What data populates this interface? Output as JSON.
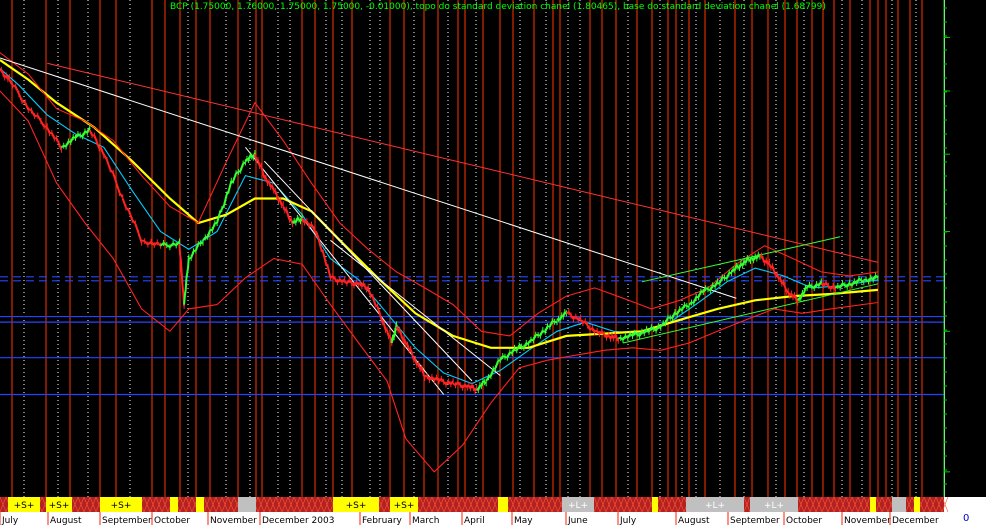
{
  "chart_data": {
    "type": "line",
    "title": "BCP (1.75000, 1.76000, 1.75000, 1.75000, -0.01000), topo do standard deviation chanel (1.80465), base do standard deviation chanel (1.68799)",
    "y_scale": "log",
    "ylim": [
      0.93,
      3.9
    ],
    "yticks": [
      "3.5",
      "3.0",
      "2.5",
      "2.0",
      "1.5",
      "1.0"
    ],
    "ytick_values": [
      3.5,
      3.0,
      2.5,
      2.0,
      1.5,
      1.0
    ],
    "month_labels": [
      "July",
      "August",
      "September",
      "October",
      "November",
      "December 2003",
      "February",
      "March",
      "April",
      "May",
      "June",
      "July",
      "August",
      "September",
      "October",
      "November",
      "December"
    ],
    "signal_labels": [
      "+S+",
      "+S+",
      "+S+",
      "+S+",
      "+S+",
      "+L+",
      "+L+",
      "+L+"
    ],
    "corner_label": "0",
    "x_range": [
      0,
      1
    ],
    "price_points": [
      [
        0.0,
        3.18
      ],
      [
        0.01,
        3.1
      ],
      [
        0.03,
        2.85
      ],
      [
        0.05,
        2.7
      ],
      [
        0.065,
        2.55
      ],
      [
        0.08,
        2.62
      ],
      [
        0.095,
        2.68
      ],
      [
        0.11,
        2.5
      ],
      [
        0.13,
        2.2
      ],
      [
        0.15,
        1.95
      ],
      [
        0.17,
        1.92
      ],
      [
        0.19,
        1.93
      ],
      [
        0.195,
        1.62
      ],
      [
        0.2,
        1.85
      ],
      [
        0.215,
        1.95
      ],
      [
        0.23,
        2.05
      ],
      [
        0.245,
        2.3
      ],
      [
        0.26,
        2.45
      ],
      [
        0.27,
        2.5
      ],
      [
        0.28,
        2.35
      ],
      [
        0.29,
        2.25
      ],
      [
        0.3,
        2.15
      ],
      [
        0.31,
        2.05
      ],
      [
        0.32,
        2.08
      ],
      [
        0.335,
        2.0
      ],
      [
        0.35,
        1.75
      ],
      [
        0.365,
        1.73
      ],
      [
        0.38,
        1.72
      ],
      [
        0.39,
        1.7
      ],
      [
        0.405,
        1.55
      ],
      [
        0.415,
        1.45
      ],
      [
        0.42,
        1.52
      ],
      [
        0.43,
        1.45
      ],
      [
        0.44,
        1.38
      ],
      [
        0.45,
        1.32
      ],
      [
        0.465,
        1.3
      ],
      [
        0.48,
        1.29
      ],
      [
        0.495,
        1.28
      ],
      [
        0.505,
        1.27
      ],
      [
        0.515,
        1.3
      ],
      [
        0.53,
        1.38
      ],
      [
        0.545,
        1.42
      ],
      [
        0.56,
        1.45
      ],
      [
        0.575,
        1.5
      ],
      [
        0.59,
        1.55
      ],
      [
        0.6,
        1.58
      ],
      [
        0.615,
        1.55
      ],
      [
        0.63,
        1.5
      ],
      [
        0.645,
        1.48
      ],
      [
        0.655,
        1.47
      ],
      [
        0.67,
        1.48
      ],
      [
        0.685,
        1.5
      ],
      [
        0.7,
        1.52
      ],
      [
        0.715,
        1.58
      ],
      [
        0.73,
        1.62
      ],
      [
        0.745,
        1.68
      ],
      [
        0.76,
        1.72
      ],
      [
        0.775,
        1.78
      ],
      [
        0.785,
        1.82
      ],
      [
        0.795,
        1.85
      ],
      [
        0.805,
        1.86
      ],
      [
        0.815,
        1.82
      ],
      [
        0.825,
        1.75
      ],
      [
        0.835,
        1.68
      ],
      [
        0.845,
        1.64
      ],
      [
        0.855,
        1.7
      ],
      [
        0.87,
        1.72
      ],
      [
        0.885,
        1.7
      ],
      [
        0.9,
        1.72
      ],
      [
        0.915,
        1.74
      ],
      [
        0.93,
        1.75
      ]
    ],
    "series": [
      {
        "color": "#00ccff",
        "values": [
          [
            0.0,
            3.2
          ],
          [
            0.02,
            3.05
          ],
          [
            0.05,
            2.8
          ],
          [
            0.08,
            2.65
          ],
          [
            0.11,
            2.55
          ],
          [
            0.14,
            2.25
          ],
          [
            0.17,
            2.0
          ],
          [
            0.2,
            1.9
          ],
          [
            0.23,
            2.0
          ],
          [
            0.26,
            2.35
          ],
          [
            0.29,
            2.3
          ],
          [
            0.32,
            2.1
          ],
          [
            0.35,
            1.85
          ],
          [
            0.38,
            1.74
          ],
          [
            0.41,
            1.58
          ],
          [
            0.44,
            1.43
          ],
          [
            0.47,
            1.33
          ],
          [
            0.5,
            1.29
          ],
          [
            0.53,
            1.34
          ],
          [
            0.56,
            1.42
          ],
          [
            0.59,
            1.5
          ],
          [
            0.62,
            1.54
          ],
          [
            0.65,
            1.5
          ],
          [
            0.68,
            1.49
          ],
          [
            0.71,
            1.54
          ],
          [
            0.74,
            1.63
          ],
          [
            0.77,
            1.73
          ],
          [
            0.8,
            1.8
          ],
          [
            0.83,
            1.76
          ],
          [
            0.86,
            1.7
          ],
          [
            0.89,
            1.71
          ],
          [
            0.93,
            1.74
          ]
        ]
      },
      {
        "color": "#ffff00",
        "values": [
          [
            0.0,
            3.28
          ],
          [
            0.03,
            3.1
          ],
          [
            0.06,
            2.9
          ],
          [
            0.1,
            2.7
          ],
          [
            0.14,
            2.45
          ],
          [
            0.18,
            2.2
          ],
          [
            0.21,
            2.05
          ],
          [
            0.24,
            2.1
          ],
          [
            0.27,
            2.2
          ],
          [
            0.3,
            2.2
          ],
          [
            0.33,
            2.12
          ],
          [
            0.36,
            1.95
          ],
          [
            0.4,
            1.75
          ],
          [
            0.44,
            1.58
          ],
          [
            0.48,
            1.48
          ],
          [
            0.52,
            1.43
          ],
          [
            0.56,
            1.43
          ],
          [
            0.6,
            1.48
          ],
          [
            0.64,
            1.49
          ],
          [
            0.68,
            1.5
          ],
          [
            0.72,
            1.55
          ],
          [
            0.76,
            1.6
          ],
          [
            0.8,
            1.64
          ],
          [
            0.84,
            1.66
          ],
          [
            0.88,
            1.67
          ],
          [
            0.93,
            1.69
          ]
        ]
      },
      {
        "color": "#ff2222",
        "name_hint": "upper_band",
        "values": [
          [
            0.0,
            3.35
          ],
          [
            0.03,
            3.15
          ],
          [
            0.06,
            2.85
          ],
          [
            0.09,
            2.75
          ],
          [
            0.12,
            2.6
          ],
          [
            0.15,
            2.35
          ],
          [
            0.18,
            2.15
          ],
          [
            0.21,
            2.05
          ],
          [
            0.24,
            2.45
          ],
          [
            0.27,
            2.9
          ],
          [
            0.3,
            2.6
          ],
          [
            0.33,
            2.3
          ],
          [
            0.36,
            2.05
          ],
          [
            0.39,
            1.9
          ],
          [
            0.42,
            1.78
          ],
          [
            0.45,
            1.7
          ],
          [
            0.48,
            1.62
          ],
          [
            0.51,
            1.5
          ],
          [
            0.54,
            1.48
          ],
          [
            0.57,
            1.58
          ],
          [
            0.6,
            1.66
          ],
          [
            0.63,
            1.7
          ],
          [
            0.66,
            1.65
          ],
          [
            0.69,
            1.6
          ],
          [
            0.72,
            1.64
          ],
          [
            0.75,
            1.7
          ],
          [
            0.78,
            1.82
          ],
          [
            0.81,
            1.92
          ],
          [
            0.84,
            1.85
          ],
          [
            0.87,
            1.78
          ],
          [
            0.9,
            1.76
          ],
          [
            0.93,
            1.78
          ]
        ]
      },
      {
        "color": "#ff2222",
        "name_hint": "lower_band",
        "values": [
          [
            0.0,
            3.0
          ],
          [
            0.03,
            2.75
          ],
          [
            0.06,
            2.3
          ],
          [
            0.09,
            2.05
          ],
          [
            0.12,
            1.85
          ],
          [
            0.15,
            1.6
          ],
          [
            0.18,
            1.5
          ],
          [
            0.2,
            1.6
          ],
          [
            0.23,
            1.62
          ],
          [
            0.26,
            1.75
          ],
          [
            0.29,
            1.85
          ],
          [
            0.32,
            1.82
          ],
          [
            0.35,
            1.62
          ],
          [
            0.38,
            1.45
          ],
          [
            0.41,
            1.3
          ],
          [
            0.43,
            1.1
          ],
          [
            0.46,
            1.0
          ],
          [
            0.49,
            1.08
          ],
          [
            0.52,
            1.22
          ],
          [
            0.55,
            1.35
          ],
          [
            0.58,
            1.38
          ],
          [
            0.61,
            1.4
          ],
          [
            0.64,
            1.42
          ],
          [
            0.67,
            1.43
          ],
          [
            0.7,
            1.42
          ],
          [
            0.73,
            1.45
          ],
          [
            0.76,
            1.5
          ],
          [
            0.79,
            1.55
          ],
          [
            0.82,
            1.6
          ],
          [
            0.85,
            1.58
          ],
          [
            0.88,
            1.6
          ],
          [
            0.93,
            1.63
          ]
        ]
      }
    ],
    "trendlines": [
      {
        "color": "#ffffff",
        "from": [
          0.0,
          3.3
        ],
        "to": [
          0.78,
          1.65
        ]
      },
      {
        "color": "#ff3333",
        "from": [
          0.05,
          3.25
        ],
        "to": [
          0.93,
          1.83
        ]
      },
      {
        "color": "#ffffff",
        "from": [
          0.26,
          2.55
        ],
        "to": [
          0.47,
          1.25
        ]
      },
      {
        "color": "#ffffff",
        "from": [
          0.28,
          2.45
        ],
        "to": [
          0.5,
          1.3
        ]
      },
      {
        "color": "#ffffff",
        "from": [
          0.35,
          1.95
        ],
        "to": [
          0.53,
          1.32
        ]
      },
      {
        "color": "#33ff33",
        "from": [
          0.68,
          1.73
        ],
        "to": [
          0.89,
          1.97
        ]
      },
      {
        "color": "#33ff33",
        "from": [
          0.66,
          1.45
        ],
        "to": [
          0.93,
          1.72
        ]
      }
    ],
    "hlines": [
      {
        "value": 1.755,
        "style": "dashed",
        "color": "#2244ff"
      },
      {
        "value": 1.735,
        "style": "dashed",
        "color": "#2244ff"
      },
      {
        "value": 1.565,
        "style": "solid",
        "color": "#2244ff"
      },
      {
        "value": 1.54,
        "style": "solid",
        "color": "#2244ff"
      },
      {
        "value": 1.39,
        "style": "solid",
        "color": "#2244ff"
      },
      {
        "value": 1.25,
        "style": "solid",
        "color": "#2244ff"
      }
    ],
    "colors": {
      "background": "#000000",
      "price_up": "#33ff33",
      "price_down": "#ff2222",
      "grid_solid": "#ff3300",
      "grid_dotted": "#ffffff",
      "axis": "#00cc00",
      "signal_label": "#ffff00",
      "signal_label_long": "#c0c0c0"
    },
    "grid": true
  }
}
